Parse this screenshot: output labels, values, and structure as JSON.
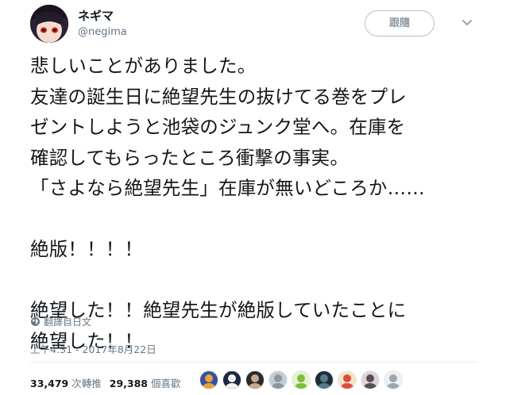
{
  "user": {
    "display_name": "ネギマ",
    "handle": "@negima"
  },
  "follow_button": {
    "label": "跟隨"
  },
  "tweet": {
    "lines": [
      "悲しいことがありました。",
      "友達の誕生日に絶望先生の抜けてる巻をプレ",
      "ゼントしようと池袋のジュンク堂へ。在庫を",
      "確認してもらったところ衝撃の事実。",
      "「さよなら絶望先生」在庫が無いどころか……",
      "",
      "絶版！！！！",
      "",
      "絶望した！！絶望先生が絶版していたことに",
      "絶望した！！"
    ],
    "translate_label": "翻譯自日文",
    "timestamp": "上午4:31 - 2017年8月22日"
  },
  "stats": {
    "retweets_count": "33,479",
    "retweets_label": "次轉推",
    "likes_count": "29,388",
    "likes_label": "個喜歡"
  },
  "likers": [
    {
      "icon": "liker-avatar",
      "bg": "#3a4f9c",
      "fg": "#e8a33a"
    },
    {
      "icon": "liker-avatar",
      "bg": "#1c2740",
      "fg": "#f2f2f2"
    },
    {
      "icon": "liker-avatar",
      "bg": "#2a2a2a",
      "fg": "#c9a98a"
    },
    {
      "icon": "liker-avatar",
      "bg": "#c3ccd4",
      "fg": "#8a97a3"
    },
    {
      "icon": "liker-avatar",
      "bg": "#e8f0d0",
      "fg": "#7bbf3a"
    },
    {
      "icon": "liker-avatar",
      "bg": "#1f2d3a",
      "fg": "#5a7a8c"
    },
    {
      "icon": "liker-avatar",
      "bg": "#f4e4c8",
      "fg": "#e04a3a"
    },
    {
      "icon": "liker-avatar",
      "bg": "#d9d5d8",
      "fg": "#5b4c58"
    },
    {
      "icon": "liker-avatar",
      "bg": "#eef0f2",
      "fg": "#9aa6b0"
    }
  ]
}
